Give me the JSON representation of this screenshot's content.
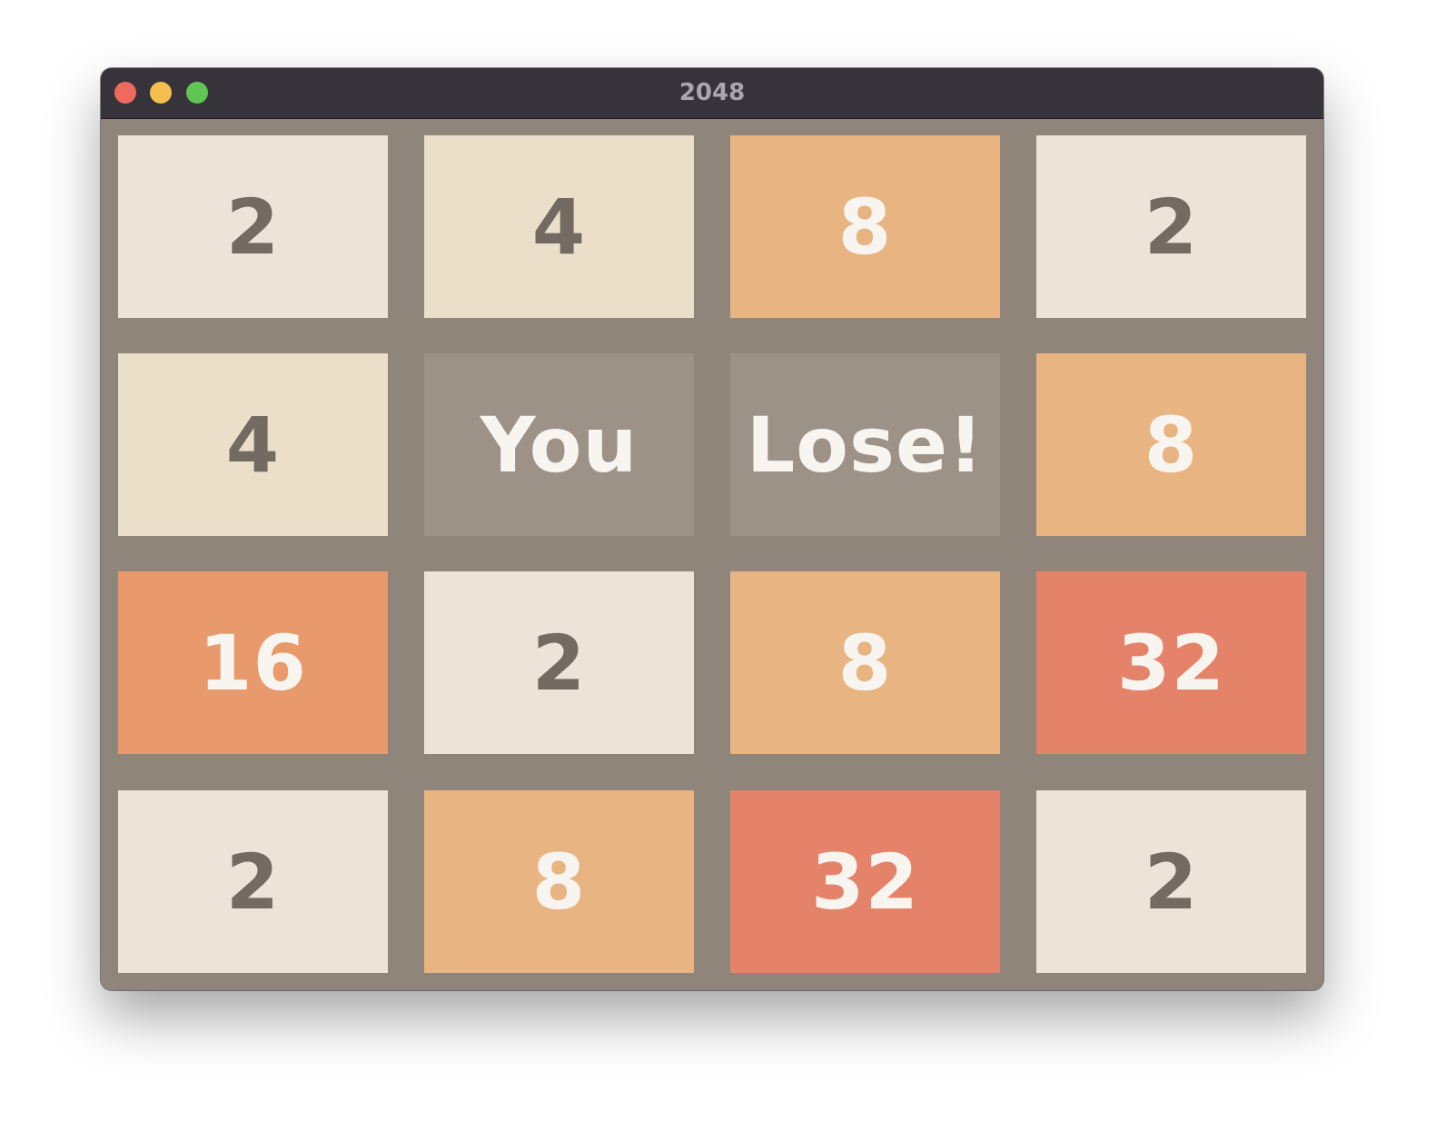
{
  "window": {
    "title": "2048"
  },
  "colors": {
    "board": "#8f857a",
    "tile_2": "#ece3d9",
    "tile_4": "#ebdfca",
    "tile_8": "#e8b482",
    "tile_16": "#e89a6c",
    "tile_32": "#e5836a",
    "message_tile": "#9c9288",
    "dark_text": "#736a61",
    "light_text": "#f8f5f0"
  },
  "board": {
    "rows": [
      [
        {
          "text": "2",
          "bg": "#ece3d9",
          "fg": "#736a61"
        },
        {
          "text": "4",
          "bg": "#ebdfca",
          "fg": "#736a61"
        },
        {
          "text": "8",
          "bg": "#e8b482",
          "fg": "#f8f5f0"
        },
        {
          "text": "2",
          "bg": "#ece3d9",
          "fg": "#736a61"
        }
      ],
      [
        {
          "text": "4",
          "bg": "#ebdfca",
          "fg": "#736a61"
        },
        {
          "text": "You",
          "bg": "#9c9288",
          "fg": "#f8f5f0"
        },
        {
          "text": "Lose!",
          "bg": "#9c9288",
          "fg": "#f8f5f0"
        },
        {
          "text": "8",
          "bg": "#e8b482",
          "fg": "#f8f5f0"
        }
      ],
      [
        {
          "text": "16",
          "bg": "#e89a6c",
          "fg": "#f8f5f0"
        },
        {
          "text": "2",
          "bg": "#ece3d9",
          "fg": "#736a61"
        },
        {
          "text": "8",
          "bg": "#e8b482",
          "fg": "#f8f5f0"
        },
        {
          "text": "32",
          "bg": "#e5836a",
          "fg": "#f8f5f0"
        }
      ],
      [
        {
          "text": "2",
          "bg": "#ece3d9",
          "fg": "#736a61"
        },
        {
          "text": "8",
          "bg": "#e8b482",
          "fg": "#f8f5f0"
        },
        {
          "text": "32",
          "bg": "#e5836a",
          "fg": "#f8f5f0"
        },
        {
          "text": "2",
          "bg": "#ece3d9",
          "fg": "#736a61"
        }
      ]
    ]
  }
}
